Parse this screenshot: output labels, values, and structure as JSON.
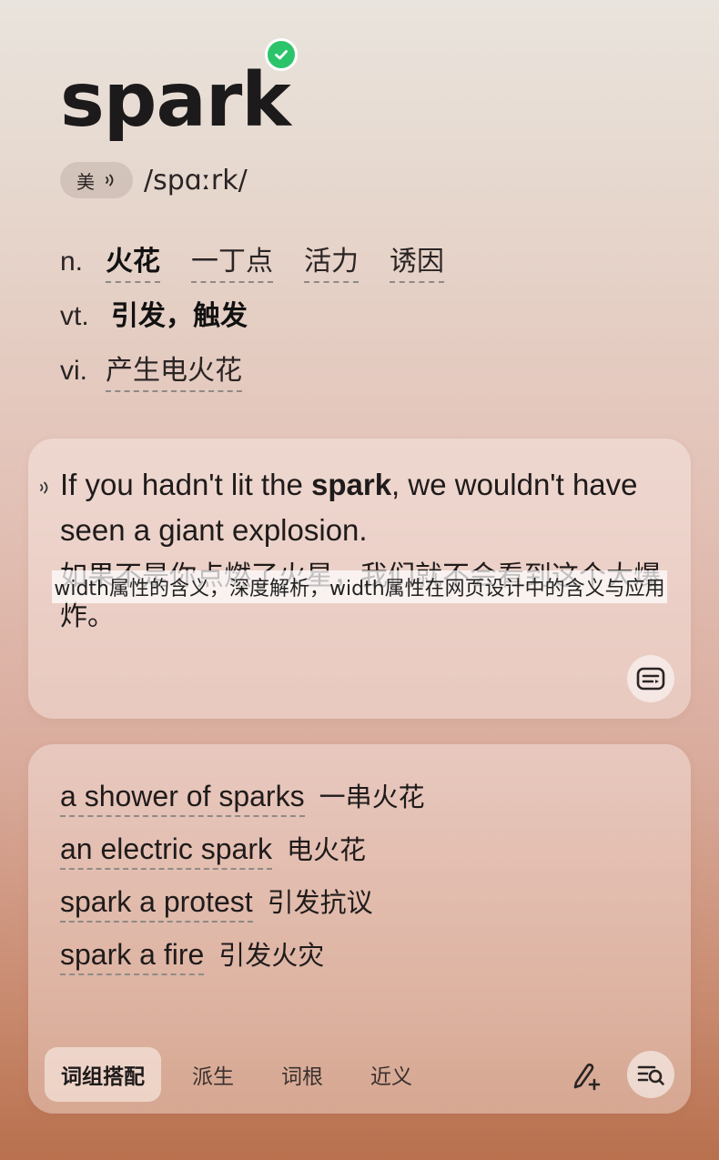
{
  "entry": {
    "word": "spark",
    "verified_icon": "check-circle-icon",
    "accent_label": "美",
    "phonetic": "/spɑːrk/"
  },
  "definitions": [
    {
      "pos": "n.",
      "meanings": [
        "火花",
        "一丁点",
        "活力",
        "诱因"
      ]
    },
    {
      "pos": "vt.",
      "meanings": [
        "引发，触发"
      ]
    },
    {
      "pos": "vi.",
      "meanings": [
        "产生电火花"
      ]
    }
  ],
  "example": {
    "en_before": "If you hadn't lit the ",
    "en_keyword": "spark",
    "en_after": ", we wouldn't have seen a giant explosion.",
    "zh": "如果不是你点燃了火星，我们就不会看到这个大爆炸。"
  },
  "overlay_caption": "width属性的含义，深度解析，width属性在网页设计中的含义与应用",
  "collocations": [
    {
      "en": "a shower of sparks",
      "zh": "一串火花"
    },
    {
      "en": "an electric spark",
      "zh": "电火花"
    },
    {
      "en": "spark a protest",
      "zh": "引发抗议"
    },
    {
      "en": "spark a fire",
      "zh": "引发火灾"
    }
  ],
  "tabs": [
    "词组搭配",
    "派生",
    "词根",
    "近义"
  ],
  "active_tab": "词组搭配",
  "colors": {
    "verified": "#2bc46a",
    "text": "#1f1b1b"
  }
}
